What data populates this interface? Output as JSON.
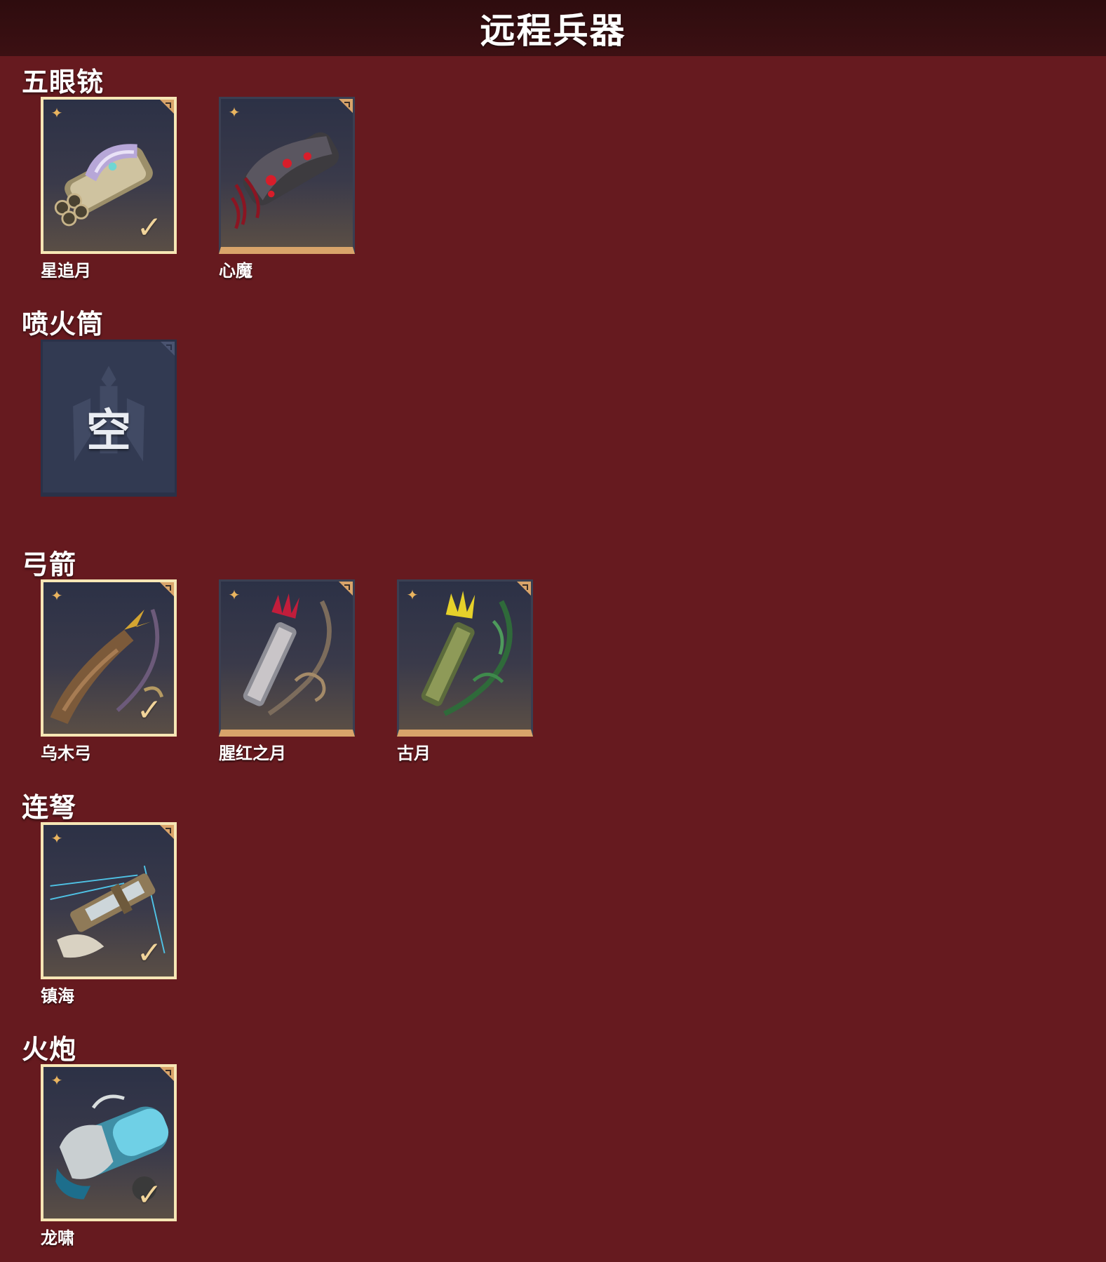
{
  "header": {
    "title": "远程兵器"
  },
  "sections": [
    {
      "title": "五眼铳",
      "items": [
        {
          "label": "星追月",
          "equipped": true,
          "art": "silver-cannon"
        },
        {
          "label": "心魔",
          "equipped": false,
          "art": "red-demon-gun"
        }
      ]
    },
    {
      "title": "喷火筒",
      "items": [
        {
          "label": "",
          "empty_text": "空",
          "empty": true
        }
      ]
    },
    {
      "title": "弓箭",
      "items": [
        {
          "label": "乌木弓",
          "equipped": true,
          "art": "ebony-bow"
        },
        {
          "label": "腥红之月",
          "equipped": false,
          "art": "crimson-bow"
        },
        {
          "label": "古月",
          "equipped": false,
          "art": "jade-bow"
        }
      ]
    },
    {
      "title": "连弩",
      "items": [
        {
          "label": "镇海",
          "equipped": true,
          "art": "sea-crossbow"
        }
      ]
    },
    {
      "title": "火炮",
      "items": [
        {
          "label": "龙啸",
          "equipped": true,
          "art": "dragon-cannon"
        }
      ]
    }
  ],
  "icons": {
    "rarity": "rarity-star-icon",
    "equipped": "checkmark-icon",
    "corner": "corner-tag-icon"
  },
  "colors": {
    "background": "#661a1f",
    "header": "#2e0c0e",
    "gold_trim": "#d9a46a",
    "equipped_border": "#f6e6b5",
    "rarity": "#e9b45f"
  }
}
